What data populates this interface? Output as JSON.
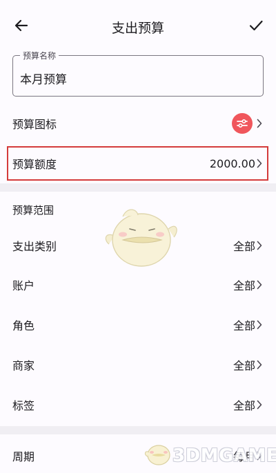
{
  "header": {
    "title": "支出预算",
    "back_icon": "arrow-left-icon",
    "confirm_icon": "check-icon"
  },
  "name_field": {
    "legend": "预算名称",
    "value": "本月预算"
  },
  "budget_icon_row": {
    "label": "预算图标",
    "icon": "sliders-icon",
    "icon_color": "#f0565c"
  },
  "amount_row": {
    "label": "预算额度",
    "value": "2000.00",
    "highlight_color": "#d43a3a"
  },
  "scope": {
    "title": "预算范围",
    "items": [
      {
        "label": "支出类别",
        "value": "全部"
      },
      {
        "label": "账户",
        "value": "全部"
      },
      {
        "label": "角色",
        "value": "全部"
      },
      {
        "label": "商家",
        "value": "全部"
      },
      {
        "label": "标签",
        "value": "全部"
      }
    ]
  },
  "period_row": {
    "label": "周期",
    "value": "每月"
  },
  "watermark": {
    "text": "3DMGAME"
  }
}
